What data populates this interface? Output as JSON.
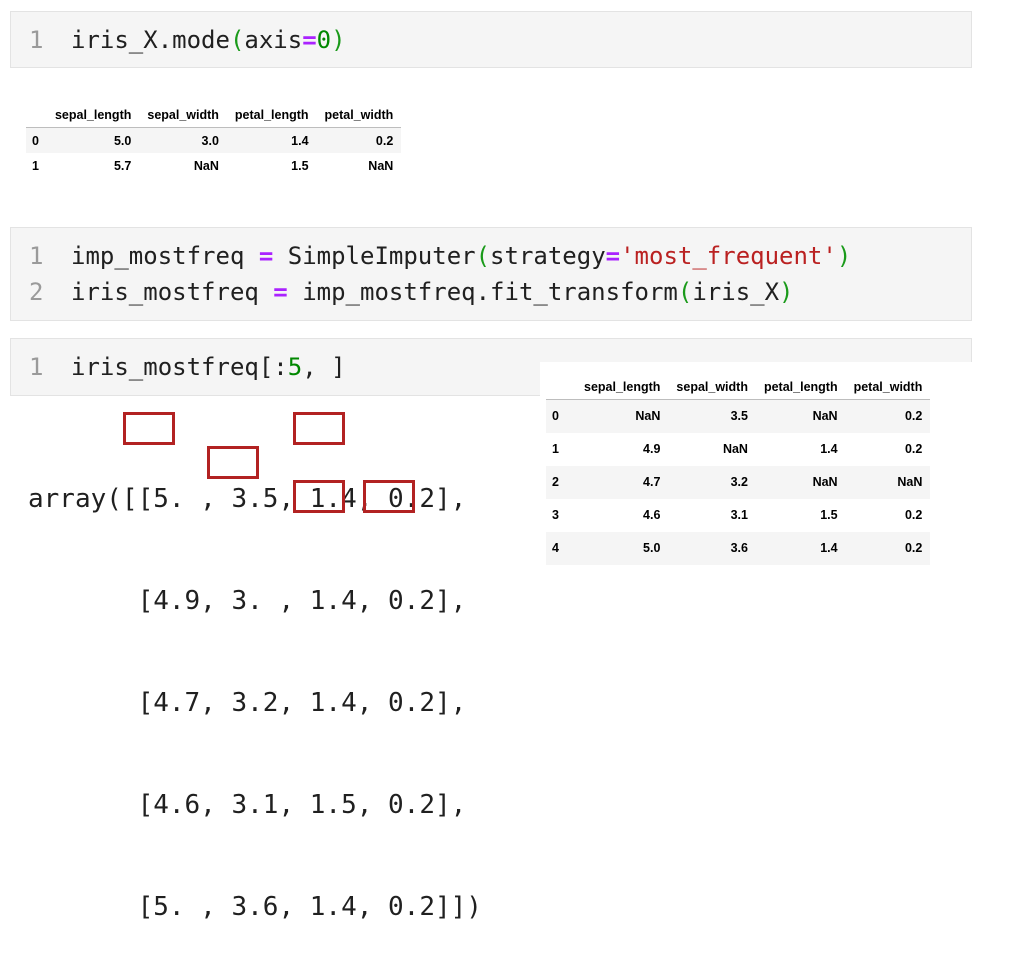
{
  "cell1": {
    "line_number": "1",
    "code": {
      "obj": "iris_X.mode",
      "open": "(",
      "arg": "axis",
      "eq": "=",
      "val": "0",
      "close": ")"
    }
  },
  "mode_table": {
    "columns": [
      "",
      "sepal_length",
      "sepal_width",
      "petal_length",
      "petal_width"
    ],
    "rows": [
      [
        "0",
        "5.0",
        "3.0",
        "1.4",
        "0.2"
      ],
      [
        "1",
        "5.7",
        "NaN",
        "1.5",
        "NaN"
      ]
    ]
  },
  "cell2": {
    "lines": [
      {
        "n": "1",
        "a": "imp_mostfreq ",
        "eq": "=",
        "b": " SimpleImputer",
        "open": "(",
        "c": "strategy",
        "eq2": "=",
        "str": "'most_frequent'",
        "close": ")"
      },
      {
        "n": "2",
        "a": "iris_mostfreq ",
        "eq": "=",
        "b": " imp_mostfreq.fit_transform",
        "open": "(",
        "c": "iris_X",
        "close": ")"
      }
    ]
  },
  "cell3": {
    "line_number": "1",
    "code": {
      "a": "iris_mostfreq[:",
      "num": "5",
      "b": ", ]"
    }
  },
  "array_output": {
    "lines": [
      "array([[5. , 3.5, 1.4, 0.2],",
      "       [4.9, 3. , 1.4, 0.2],",
      "       [4.7, 3.2, 1.4, 0.2],",
      "       [4.6, 3.1, 1.5, 0.2],",
      "       [5. , 3.6, 1.4, 0.2]])"
    ]
  },
  "missing_table": {
    "columns": [
      "",
      "sepal_length",
      "sepal_width",
      "petal_length",
      "petal_width"
    ],
    "rows": [
      [
        "0",
        "NaN",
        "3.5",
        "NaN",
        "0.2"
      ],
      [
        "1",
        "4.9",
        "NaN",
        "1.4",
        "0.2"
      ],
      [
        "2",
        "4.7",
        "3.2",
        "NaN",
        "NaN"
      ],
      [
        "3",
        "4.6",
        "3.1",
        "1.5",
        "0.2"
      ],
      [
        "4",
        "5.0",
        "3.6",
        "1.4",
        "0.2"
      ]
    ]
  },
  "colors": {
    "highlight": "#b22222",
    "keyword": "#aa22ff",
    "number": "#008800",
    "string": "#ba2121"
  }
}
